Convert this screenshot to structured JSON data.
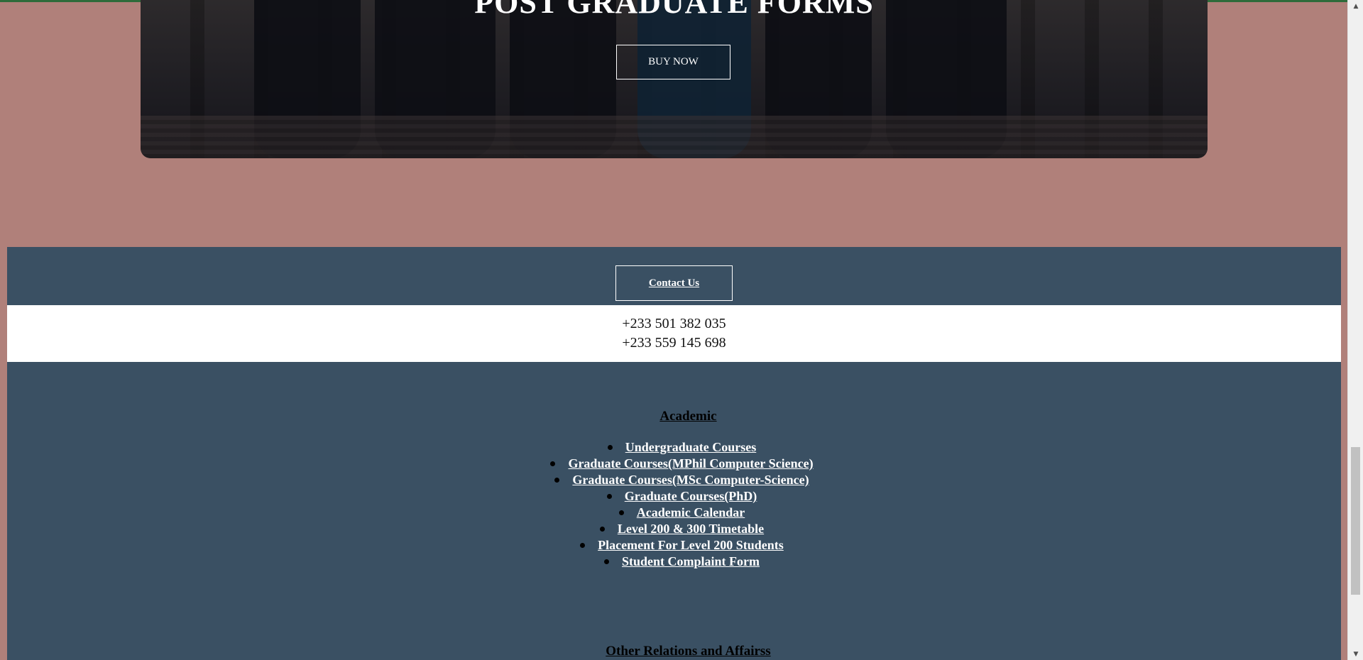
{
  "hero": {
    "title": "POST GRADUATE FORMS",
    "buy_button": "BUY NOW"
  },
  "footer": {
    "contact_button": "Contact Us",
    "phones": [
      "+233 501 382 035",
      "+233 559 145 698"
    ],
    "academic": {
      "title": "Academic",
      "links": [
        "Undergraduate Courses",
        "Graduate Courses(MPhil Computer Science)",
        "Graduate Courses(MSc Computer-Science)",
        "Graduate Courses(PhD)",
        "Academic Calendar",
        "Level 200 & 300 Timetable",
        "Placement For Level 200 Students",
        "Student Complaint Form"
      ]
    },
    "other": {
      "title": "Other Relations and Affairss"
    }
  },
  "scrollbar": {
    "up_icon": "▲",
    "down_icon": "▼"
  },
  "colors": {
    "page_background": "#b0807a",
    "footer_background": "#3a5063",
    "top_accent": "#2e6b3a"
  }
}
